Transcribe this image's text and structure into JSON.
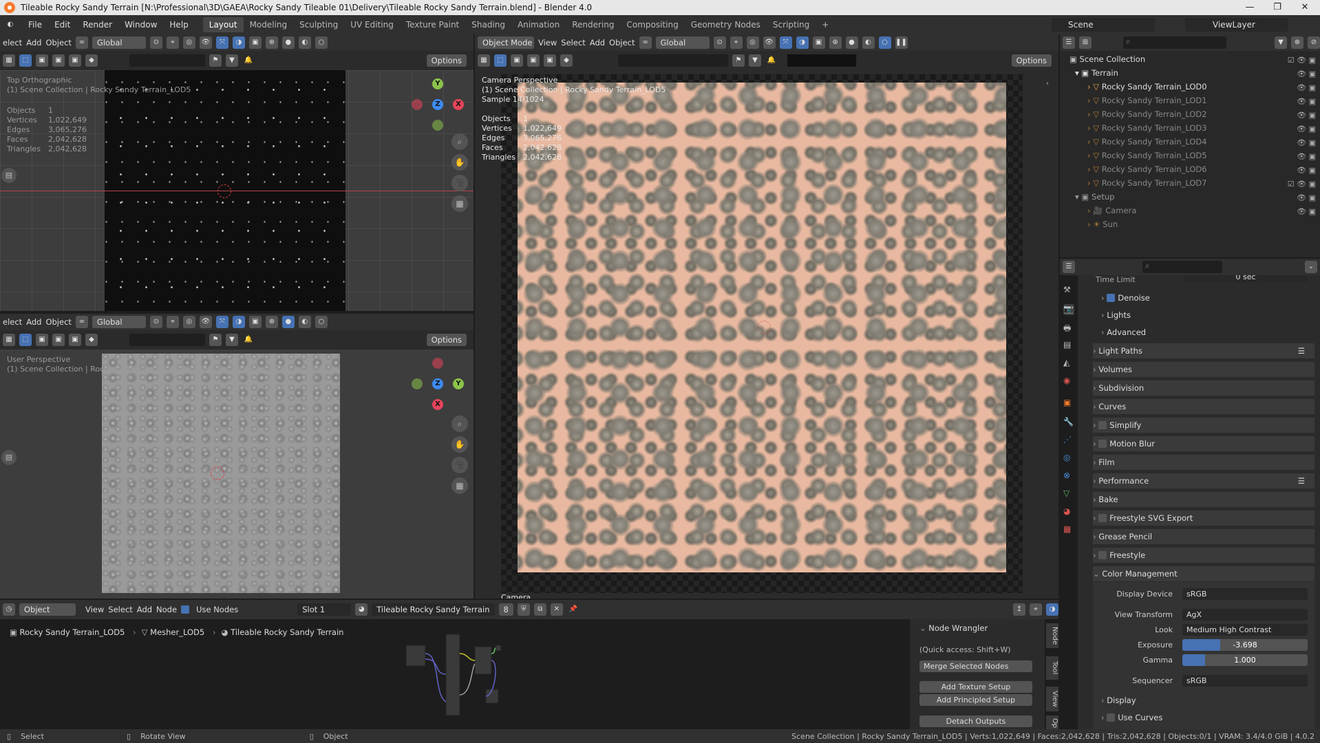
{
  "window": {
    "title": "Tileable Rocky Sandy Terrain [N:\\Professional\\3D\\GAEA\\Rocky Sandy Tileable 01\\Delivery\\Tileable Rocky Sandy Terrain.blend] - Blender 4.0",
    "controls": [
      "—",
      "❐",
      "✕"
    ]
  },
  "menu": [
    "File",
    "Edit",
    "Render",
    "Window",
    "Help"
  ],
  "workspaces": [
    "Layout",
    "Modeling",
    "Sculpting",
    "UV Editing",
    "Texture Paint",
    "Shading",
    "Animation",
    "Rendering",
    "Compositing",
    "Geometry Nodes",
    "Scripting",
    "+"
  ],
  "scene": {
    "name": "Scene",
    "view_layer": "ViewLayer"
  },
  "viewport_tl": {
    "menus": [
      "elect",
      "Add",
      "Object"
    ],
    "orientation": "Global",
    "options": "Options",
    "view_name": "Top Orthographic",
    "collection": "(1) Scene Collection | Rocky Sandy Terrain_LOD5",
    "stats_labels": [
      "Objects",
      "Vertices",
      "Edges",
      "Faces",
      "Triangles"
    ],
    "stats_values": [
      "1",
      "1,022,649",
      "3,065,276",
      "2,042,628",
      "2,042,628"
    ]
  },
  "viewport_bl": {
    "menus": [
      "elect",
      "Add",
      "Object"
    ],
    "orientation": "Global",
    "options": "Options",
    "view_name": "User Perspective",
    "collection": "(1) Scene Collection | Rocky Sandy Terrain_LOD5"
  },
  "viewport_main": {
    "mode": "Object Mode",
    "menus": [
      "View",
      "Select",
      "Add",
      "Object"
    ],
    "orientation": "Global",
    "options": "Options",
    "view_name": "Camera Perspective",
    "collection": "(1) Scene Collection | Rocky Sandy Terrain_LOD5",
    "sample": "Sample 14/1024",
    "stats_labels": [
      "Objects",
      "Vertices",
      "Edges",
      "Faces",
      "Triangles"
    ],
    "stats_values": [
      "1",
      "1,022,649",
      "3,065,276",
      "2,042,628",
      "2,042,628"
    ],
    "camera_label": "Camera"
  },
  "gizmo_axes": {
    "x": "X",
    "y": "Y",
    "z": "Z"
  },
  "outliner": {
    "root": "Scene Collection",
    "collections": [
      {
        "name": "Terrain",
        "items": [
          "Rocky Sandy Terrain_LOD0",
          "Rocky Sandy Terrain_LOD1",
          "Rocky Sandy Terrain_LOD2",
          "Rocky Sandy Terrain_LOD3",
          "Rocky Sandy Terrain_LOD4",
          "Rocky Sandy Terrain_LOD5",
          "Rocky Sandy Terrain_LOD6",
          "Rocky Sandy Terrain_LOD7"
        ]
      },
      {
        "name": "Setup",
        "items": [
          "Camera",
          "Sun"
        ]
      }
    ]
  },
  "properties": {
    "time_limit_label": "Time Limit",
    "time_limit_value": "0 sec",
    "sub_items": [
      "Denoise",
      "Lights",
      "Advanced"
    ],
    "panels": [
      "Light Paths",
      "Volumes",
      "Subdivision",
      "Curves",
      "Simplify",
      "Motion Blur",
      "Film",
      "Performance",
      "Bake",
      "Freestyle SVG Export",
      "Grease Pencil",
      "Freestyle",
      "Color Management"
    ],
    "color_management": {
      "display_device_label": "Display Device",
      "display_device": "sRGB",
      "view_transform_label": "View Transform",
      "view_transform": "AgX",
      "look_label": "Look",
      "look": "Medium High Contrast",
      "exposure_label": "Exposure",
      "exposure": "-3.698",
      "exposure_fill": 0.3,
      "gamma_label": "Gamma",
      "gamma": "1.000",
      "gamma_fill": 0.18,
      "sequencer_label": "Sequencer",
      "sequencer": "sRGB",
      "sub": [
        "Display",
        "Use Curves"
      ]
    }
  },
  "node_editor": {
    "object_type": "Object",
    "menus": [
      "View",
      "Select",
      "Add",
      "Node"
    ],
    "use_nodes": "Use Nodes",
    "slot": "Slot 1",
    "material": "Tileable Rocky Sandy Terrain",
    "users": "8",
    "breadcrumb": [
      "Rocky Sandy Terrain_LOD5",
      "Mesher_LOD5",
      "Tileable Rocky Sandy Terrain"
    ]
  },
  "node_wrangler": {
    "title": "Node Wrangler",
    "quick": "(Quick access: Shift+W)",
    "merge": "Merge Selected Nodes",
    "buttons": [
      "Add Texture Setup",
      "Add Principled Setup",
      "Detach Outputs"
    ],
    "tabs": [
      "Node",
      "Tool",
      "View",
      "Op"
    ]
  },
  "status": {
    "select": "Select",
    "rotate": "Rotate View",
    "object": "Object",
    "info": "Scene Collection | Rocky Sandy Terrain_LOD5 | Verts:1,022,649 | Faces:2,042,628 | Tris:2,042,628 | Objects:0/1 | VRAM: 3.4/4.0 GiB | 4.0.2"
  },
  "colors": {
    "accent": "#4772b3",
    "orange": "#f5792a",
    "sand": "#e8b9a0",
    "x_axis": "#e5445a",
    "y_axis": "#8bc34a",
    "z_axis": "#3d8bf0"
  }
}
